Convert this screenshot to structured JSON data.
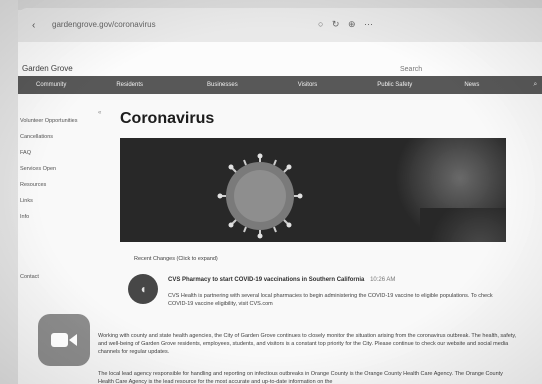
{
  "browser": {
    "back_glyph": "‹",
    "url": "gardengrove.gov/coronavirus",
    "tools_glyphs": "○ ↻ ⊕ ⋯"
  },
  "site": {
    "name": "Garden Grove",
    "search_label": "Search"
  },
  "nav": {
    "items": [
      "Community",
      "Residents",
      "Businesses",
      "Visitors",
      "Public Safety",
      "News"
    ],
    "search_glyph": "⌕"
  },
  "sidebar": {
    "toggle_glyph": "«",
    "items": [
      "Volunteer Opportunities",
      "Cancellations",
      "FAQ",
      "Services Open",
      "Resources",
      "Links",
      "Info",
      "Contact"
    ]
  },
  "main": {
    "title": "Coronavirus",
    "recent_changes": "Recent Changes (Click to expand)",
    "news_item": {
      "icon_glyph": "◖",
      "headline": "CVS Pharmacy to start COVID-19 vaccinations in Southern California",
      "time": "10:26 AM",
      "text": "CVS Health is partnering with several local pharmacies to begin administering the COVID-19 vaccine to eligible populations. To check COVID-19 vaccine eligibility, visit CVS.com"
    },
    "body1": "Working with county and state health agencies, the City of Garden Grove continues to closely monitor the situation arising from the coronavirus outbreak. The health, safety, and well-being of Garden Grove residents, employees, students, and visitors is a constant top priority for the City. Please continue to check our website and social media channels for regular updates.",
    "body2": "The local lead agency responsible for handling and reporting on infectious outbreaks in Orange County is the Orange County Health Care Agency. The Orange County Health Care Agency is the lead resource for the most accurate and up-to-date information on the"
  },
  "dock": {
    "facetime_label": "FaceTime"
  }
}
